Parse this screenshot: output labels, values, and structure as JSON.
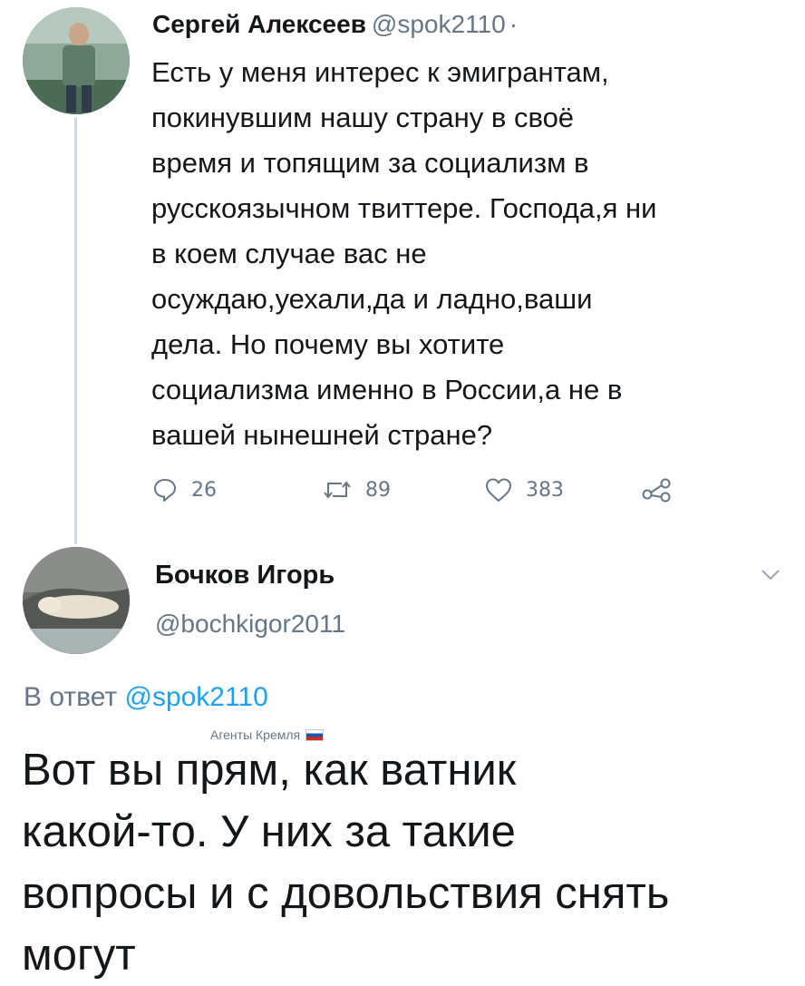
{
  "tweet1": {
    "author_name": "Сергей Алексеев",
    "author_handle": "@spok2110",
    "separator": "·",
    "text_lines": [
      "Есть у меня интерес к эмигрантам,",
      "покинувшим нашу страну в своё",
      "время и топящим за социализм в",
      "русскоязычном твиттере. Господа,я ни",
      "в коем случае вас не",
      "осуждаю,уехали,да и ладно,ваши",
      "дела. Но почему вы хотите",
      "социализма именно в России,а не в",
      "вашей нынешней стране?"
    ],
    "replies": "26",
    "retweets": "89",
    "likes": "383"
  },
  "tweet2": {
    "author_name": "Бочков Игорь",
    "author_handle": "@bochkigor2011",
    "reply_prefix": "В ответ",
    "reply_to": "@spok2110",
    "caption": "Агенты Кремля",
    "text_lines": [
      "Вот вы прям, как ватник",
      "какой-то. У них за такие",
      "вопросы и с довольствия снять",
      "могут"
    ]
  },
  "icons": {
    "reply": "reply-icon",
    "retweet": "retweet-icon",
    "like": "heart-icon",
    "share": "share-icon",
    "menu": "chevron-down-icon"
  },
  "colors": {
    "text": "#14171a",
    "secondary": "#657786",
    "link": "#1da1f2",
    "thread_line": "#cfd9de"
  }
}
